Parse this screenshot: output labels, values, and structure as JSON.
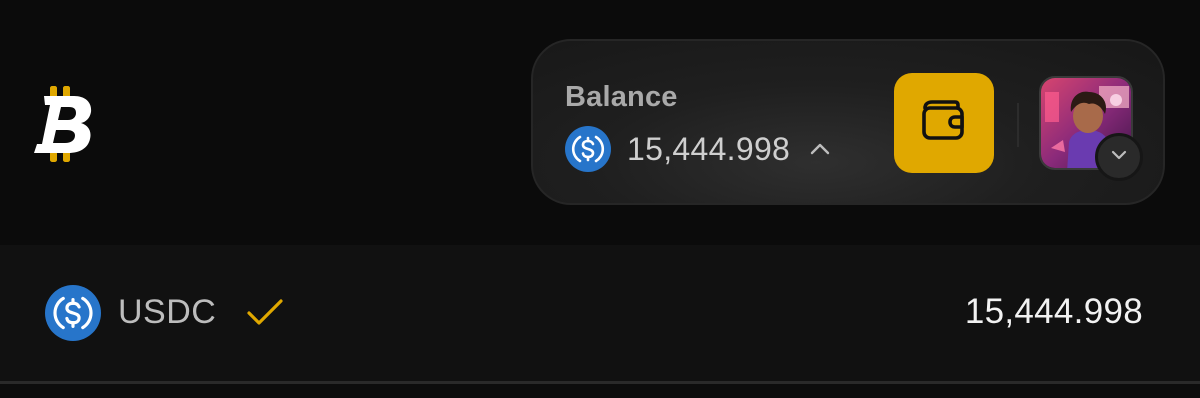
{
  "header": {
    "logo_icon": "bitcoin-b-logo-icon",
    "brand_color": "#e0a800"
  },
  "balance_card": {
    "label": "Balance",
    "currency_icon": "usdc-coin-icon",
    "amount": "15,444.998",
    "expand_icon": "chevron-up-icon",
    "wallet_icon": "wallet-icon",
    "avatar_icon": "user-avatar",
    "dropdown_icon": "chevron-down-icon"
  },
  "asset_list": {
    "rows": [
      {
        "icon": "usdc-coin-icon",
        "symbol": "USDC",
        "selected_icon": "check-icon",
        "amount": "15,444.998"
      }
    ]
  },
  "colors": {
    "accent": "#e0a800",
    "usdc_blue": "#2775ca",
    "background": "#0b0b0b",
    "row_background": "#111111"
  }
}
